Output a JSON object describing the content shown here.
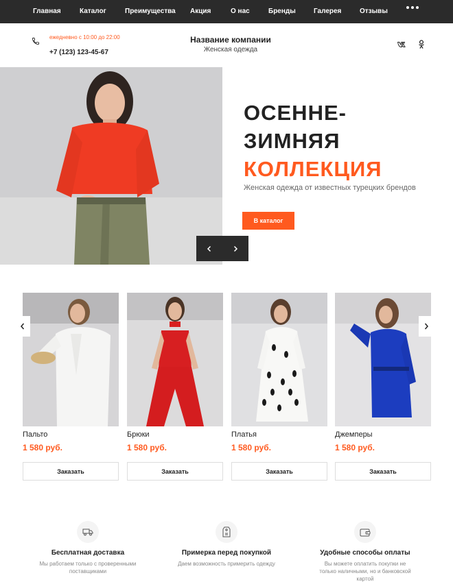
{
  "nav": {
    "items": [
      "Главная",
      "Каталог",
      "Преимущества",
      "Акция",
      "О нас",
      "Бренды",
      "Галерея",
      "Отзывы"
    ],
    "more_icon": "more-dots-icon"
  },
  "header": {
    "hours": "ежедневно с 10:00 до 22:00",
    "phone": "+7 (123) 123-45-67",
    "company_name": "Название компании",
    "company_sub": "Женская одежда",
    "icons": [
      "phone-icon",
      "vk-icon",
      "odnoklassniki-icon"
    ]
  },
  "hero": {
    "title_line1": "ОСЕННЕ-",
    "title_line2": "ЗИМНЯЯ",
    "title_accent": "КОЛЛЕКЦИЯ",
    "subtitle": "Женская одежда от известных турецких брендов",
    "button": "В каталог",
    "accent_color": "#ff5a1f"
  },
  "products": [
    {
      "name": "Пальто",
      "price": "1 580 руб.",
      "button": "Заказать"
    },
    {
      "name": "Брюки",
      "price": "1 580 руб.",
      "button": "Заказать"
    },
    {
      "name": "Платья",
      "price": "1 580 руб.",
      "button": "Заказать"
    },
    {
      "name": "Джемперы",
      "price": "1 580 руб.",
      "button": "Заказать"
    }
  ],
  "features": [
    {
      "title": "Бесплатная доставка",
      "desc": "Мы работаем только с проверенными поставщиками",
      "icon": "delivery-truck-icon"
    },
    {
      "title": "Примерка перед покупкой",
      "desc": "Даем возможность примерить одежду",
      "icon": "fitting-tag-icon"
    },
    {
      "title": "Удобные способы оплаты",
      "desc": "Вы можете оплатить покупки не только наличными, но и банковской картой",
      "icon": "wallet-icon"
    }
  ]
}
